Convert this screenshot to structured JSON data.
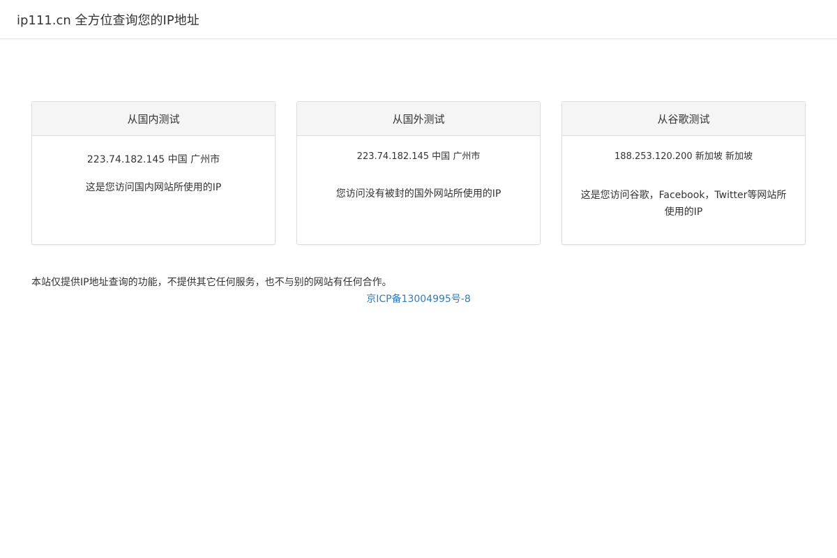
{
  "navbar": {
    "brand": "ip111.cn 全方位查询您的IP地址"
  },
  "panels": [
    {
      "heading": "从国内测试",
      "ip_info": "223.74.182.145 中国 广州市",
      "description": "这是您访问国内网站所使用的IP"
    },
    {
      "heading": "从国外测试",
      "ip_info": "223.74.182.145 中国 广州市",
      "description": "您访问没有被封的国外网站所使用的IP"
    },
    {
      "heading": "从谷歌测试",
      "ip_info": "188.253.120.200 新加坡 新加坡",
      "description": "这是您访问谷歌，Facebook，Twitter等网站所使用的IP"
    }
  ],
  "footer": {
    "note": "本站仅提供IP地址查询的功能，不提供其它任何服务，也不与别的网站有任何合作。",
    "icp": "京ICP备13004995号-8"
  },
  "colors": {
    "link": "#337ab7",
    "panel_heading_bg": "#f5f5f5",
    "border": "#dddddd"
  }
}
